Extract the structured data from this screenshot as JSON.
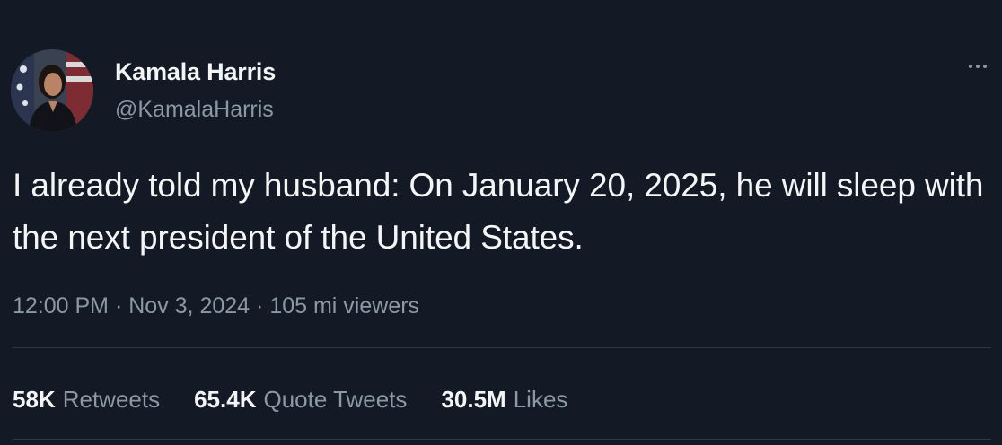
{
  "tweet": {
    "author": {
      "display_name": "Kamala Harris",
      "handle": "@KamalaHarris",
      "avatar_icon": "profile-photo"
    },
    "text": "I already told my husband: On January 20, 2025, he will sleep with the next president of the United States.",
    "meta": {
      "time": "12:00 PM",
      "separator": "·",
      "date": "Nov 3, 2024",
      "views": "105 mi viewers"
    },
    "stats": {
      "retweets": {
        "count": "58K",
        "label": "Retweets"
      },
      "quotes": {
        "count": "65.4K",
        "label": "Quote Tweets"
      },
      "likes": {
        "count": "30.5M",
        "label": "Likes"
      }
    }
  },
  "colors": {
    "background": "#141a25",
    "primary_text": "#f3f5f7",
    "secondary_text": "#8b98a5",
    "divider": "#2f3640"
  }
}
